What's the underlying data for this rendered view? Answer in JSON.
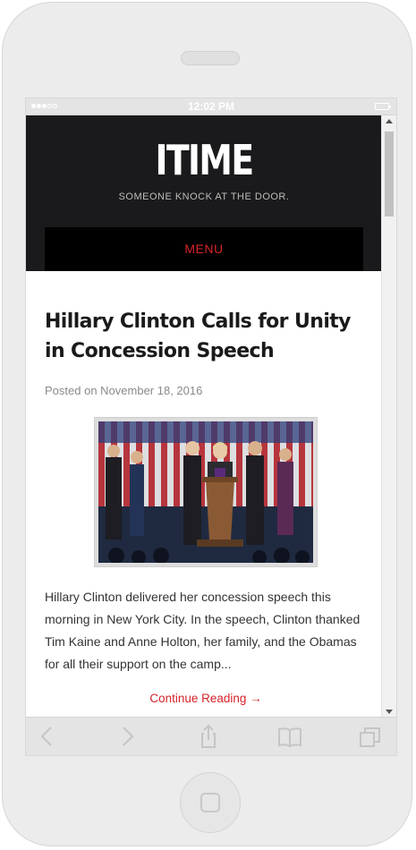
{
  "status_bar": {
    "time": "12:02 PM"
  },
  "site": {
    "title": "ITIME",
    "tagline": "SOMEONE KNOCK AT THE DOOR.",
    "menu_label": "MENU",
    "accent_color": "#d6232a",
    "header_color": "#1a1a1c"
  },
  "post": {
    "title": "Hillary Clinton Calls for Unity in Concession Speech",
    "meta_prefix": "Posted on",
    "date": "November 18, 2016",
    "excerpt": "Hillary Clinton delivered her concession speech this morning in New York City. In the speech, Clinton thanked Tim Kaine and Anne Holton, her family, and the Obamas for all their support on the camp...",
    "continue_label": "Continue Reading →"
  },
  "toolbar": {
    "icons": [
      "back-icon",
      "forward-icon",
      "share-icon",
      "bookmarks-icon",
      "tabs-icon"
    ]
  }
}
